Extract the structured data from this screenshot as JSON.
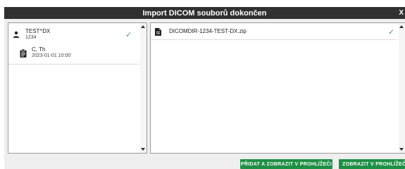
{
  "dialog": {
    "title": "Import DICOM souborů dokončen",
    "corner_glyph": "X"
  },
  "left_panel": {
    "patient": {
      "name": "TEST^DX",
      "id": "1234",
      "icon": "person-icon",
      "status_icon": "check-icon",
      "status_glyph": "✓"
    },
    "study": {
      "name": "C, Th",
      "date": "2023-01-01 10:00",
      "icon": "clipboard-icon"
    }
  },
  "right_panel": {
    "files": [
      {
        "name": "DICOMDIR-1234-TEST-DX.zip",
        "icon": "file-icon",
        "status_icon": "check-icon",
        "status_glyph": "✓"
      }
    ]
  },
  "buttons": {
    "add_and_view": "PŘIDAT A ZOBRAZIT V PROHLÍŽEČI",
    "view": "ZOBRAZIT V PROHLÍŽEČI"
  },
  "colors": {
    "titlebar": "#303030",
    "background": "#efefef",
    "accent_green": "#1e9045",
    "check_green": "#3fa14f"
  }
}
